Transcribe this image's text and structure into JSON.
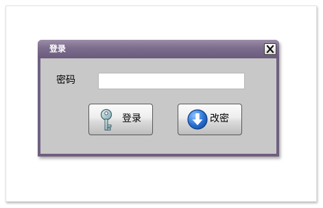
{
  "dialog": {
    "title": "登录",
    "close_icon": "close-x-icon"
  },
  "form": {
    "password_label": "密码",
    "password_value": "",
    "password_placeholder": ""
  },
  "buttons": {
    "login_label": "登录",
    "login_icon": "key-icon",
    "change_label": "改密",
    "change_icon": "down-arrow-circle-icon"
  },
  "colors": {
    "titlebar": "#7c6c8d",
    "client_background": "#c8c8c8",
    "arrow_icon_blue": "#2a72d6"
  }
}
